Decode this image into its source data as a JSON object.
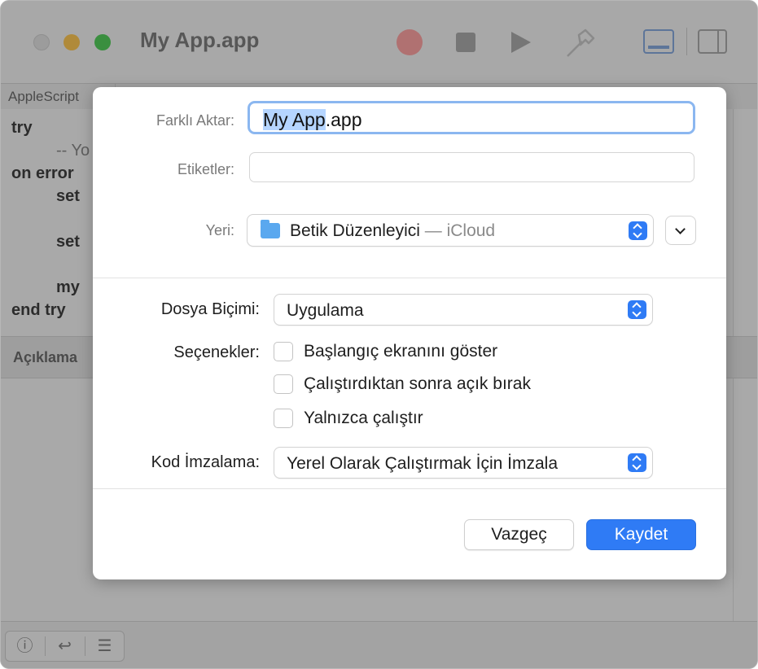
{
  "window": {
    "title": "My App.app"
  },
  "editor": {
    "language": "AppleScript",
    "code_lines": [
      "try",
      "-- Yo",
      "on error",
      "set",
      "set",
      "my",
      "end try"
    ],
    "description_label": "Açıklama"
  },
  "bottom_bar": {
    "info_icon": "ⓘ",
    "return_icon": "↩",
    "list_icon": "☰"
  },
  "sheet": {
    "save_as_label": "Farklı Aktar:",
    "save_as_value_selected": "My App",
    "save_as_value_rest": ".app",
    "tags_label": "Etiketler:",
    "tags_value": "",
    "where_label": "Yeri:",
    "where_folder": "Betik Düzenleyici",
    "where_location": " — iCloud",
    "file_format_label": "Dosya Biçimi:",
    "file_format_value": "Uygulama",
    "options_label": "Seçenekler:",
    "options": [
      {
        "label": "Başlangıç ekranını göster",
        "checked": false
      },
      {
        "label": "Çalıştırdıktan sonra açık bırak",
        "checked": false
      },
      {
        "label": "Yalnızca çalıştır",
        "checked": false
      }
    ],
    "code_signing_label": "Kod İmzalama:",
    "code_signing_value": "Yerel Olarak Çalıştırmak İçin İmzala",
    "cancel_label": "Vazgeç",
    "save_label": "Kaydet"
  },
  "colors": {
    "accent": "#2f7bf5",
    "focus_ring": "#8bb7f0"
  }
}
